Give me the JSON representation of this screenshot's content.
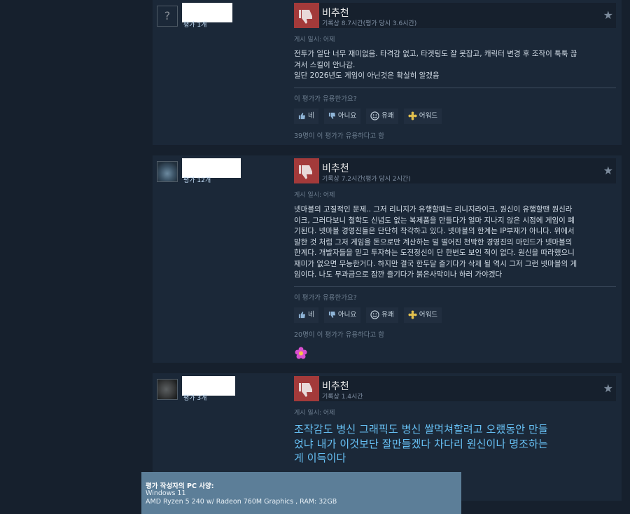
{
  "controls": {
    "yes_label": "네",
    "no_label": "아니요",
    "funny_label": "유쾌",
    "award_label": "어워드",
    "helpful_question": "이 평가가 유용한가요?"
  },
  "reviews": [
    {
      "author_review_count": "평가 1개",
      "vote": "비추천",
      "hours": "기록상 8.7시간(평가 당시 3.6시간)",
      "posted": "게시 일시: 어제",
      "text_lines": [
        "전투가 일단 너무 재미없음. 타격감 없고, 타겟팅도 잘 못잡고, 캐릭터 변경 후 조작이 툭툭 끊",
        "겨서 스킬이 안나감.",
        "일단 2026년도 게임이 아닌것은 확실히 알겠음"
      ],
      "helpful_count": "39명이 이 평가가 유용하다고 함"
    },
    {
      "author_review_count": "평가 12개",
      "vote": "비추천",
      "hours": "기록상 7.2시간(평가 당시 2시간)",
      "posted": "게시 일시: 어제",
      "text_lines": [
        "넷마블의 고질적인 문제.. 그저 리니지가 유행할때는 리니지라이크, 원신이 유행할땐 원신라",
        "이크, 그러다보니 철학도 신념도 없는 복제품을 만들다가 얼마 지나지 않은 시점에 게임이 폐",
        "기된다. 넷마블 경영진들은 단단히 착각하고 있다. 넷마블의 한계는 IP부재가 아니다. 위에서",
        "말한 것 처럼 그저 게임을 돈으로만 계산하는 덜 떨어진 천박한 경영진의 마인드가 넷마블의",
        "한계다. 개발자들을 믿고 투자하는 도전정신이 단 한번도 보인 적이 없다. 원신을 따라했으니",
        "재미가 없으면 무능한거다. 하지만 결국 한두달 즐기다가 삭제 될 역시 그저 그런 넷마블의 게",
        "임이다. 나도 무과금으로 잠깐 즐기다가 붉은사막이나 하러 가야겠다"
      ],
      "helpful_count": "20명이 이 평가가 유용하다고 함"
    },
    {
      "author_review_count": "평가 3개",
      "vote": "비추천",
      "hours": "기록상 1.4시간",
      "posted": "게시 일시: 어제",
      "text_lines": [
        "조작감도 병신 그래픽도 병신 쌀먹쳐할려고 오랬동안 만들",
        "었냐 내가 이것보단 잘만들겠다 차다리 원신이나 명조하는",
        "게 이득이다"
      ],
      "specs_title": "평가 작성자의 PC 사양:",
      "specs_os": "Windows 11",
      "specs_cpu": "AMD Ryzen 5 240 w/ Radeon 760M Graphics , RAM: 32GB"
    }
  ],
  "colors": {
    "background": "#16202d",
    "card": "#1b2838",
    "thumb_down": "#a33a3a",
    "accent_text": "#67c1f5"
  }
}
